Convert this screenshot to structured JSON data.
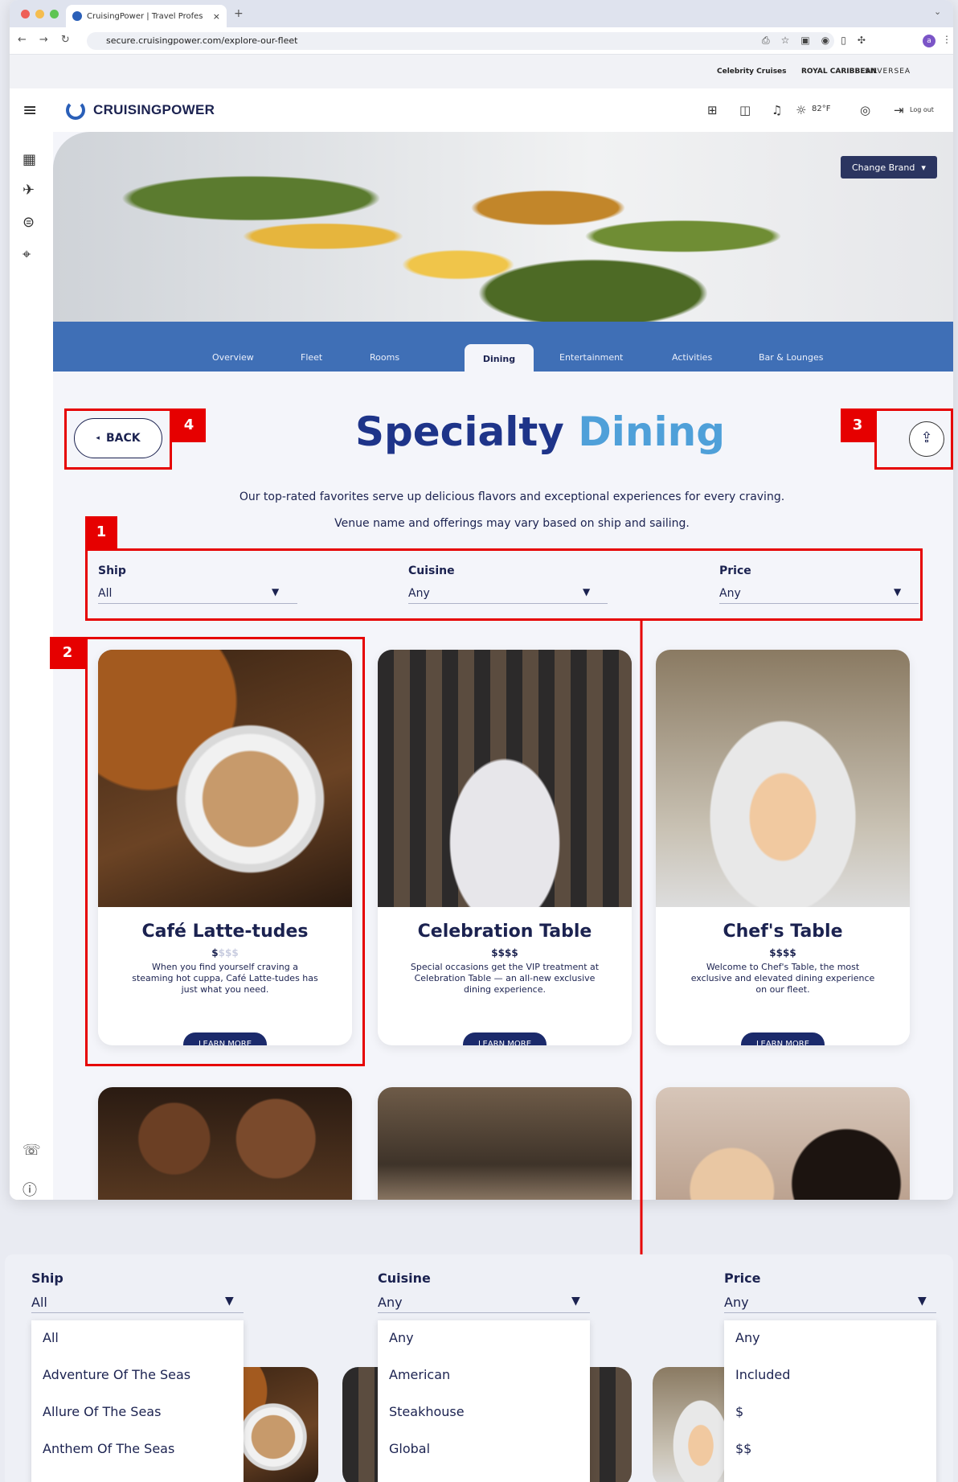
{
  "browser": {
    "tab_title": "CruisingPower | Travel Profes",
    "tab_close": "×",
    "new_tab": "+",
    "url": "secure.cruisingpower.com/explore-our-fleet",
    "profile_initial": "a"
  },
  "brands": [
    "Celebrity Cruises",
    "ROYAL CARIBBEAN",
    "SILVERSEA"
  ],
  "header": {
    "logo": "CRUISINGPOWER",
    "weather": "82°F",
    "logout": "Log out"
  },
  "hero": {
    "change_brand": "Change Brand"
  },
  "tabs": [
    "Overview",
    "Fleet",
    "Rooms",
    "Dining",
    "Entertainment",
    "Activities",
    "Bar & Lounges"
  ],
  "page": {
    "back": "BACK",
    "title_part1": "Specialty",
    "title_part2": "Dining",
    "intro1": "Our top-rated favorites serve up delicious flavors and exceptional experiences for every craving.",
    "intro2": "Venue name and offerings may vary based on ship and sailing."
  },
  "filters": {
    "ship_label": "Ship",
    "ship_value": "All",
    "cuisine_label": "Cuisine",
    "cuisine_value": "Any",
    "price_label": "Price",
    "price_value": "Any"
  },
  "cards": [
    {
      "title": "Café Latte-tudes",
      "price": "$",
      "price_muted": "$$$",
      "desc": "When you find yourself craving a steaming hot cuppa, Café Latte-tudes has just what you need.",
      "cta": "LEARN MORE"
    },
    {
      "title": "Celebration Table",
      "price": "$$$$",
      "price_muted": "",
      "desc": "Special occasions get the VIP treatment at Celebration Table — an all-new exclusive dining experience.",
      "cta": "LEARN MORE"
    },
    {
      "title": "Chef's Table",
      "price": "$$$$",
      "price_muted": "",
      "desc": "Welcome to Chef's Table, the most exclusive and elevated dining experience on our fleet.",
      "cta": "LEARN MORE"
    }
  ],
  "annotations": [
    "1",
    "2",
    "3",
    "4"
  ],
  "dropdowns": {
    "ship_options": [
      "All",
      "Adventure Of The Seas",
      "Allure Of The Seas",
      "Anthem Of The Seas"
    ],
    "cuisine_options": [
      "Any",
      "American",
      "Steakhouse",
      "Global"
    ],
    "price_options": [
      "Any",
      "Included",
      "$",
      "$$"
    ]
  },
  "colors": {
    "brand_navy": "#1b2250",
    "nav_blue": "#3f6fb6",
    "title_light": "#4fa0d9",
    "annotation_red": "#e60000"
  }
}
